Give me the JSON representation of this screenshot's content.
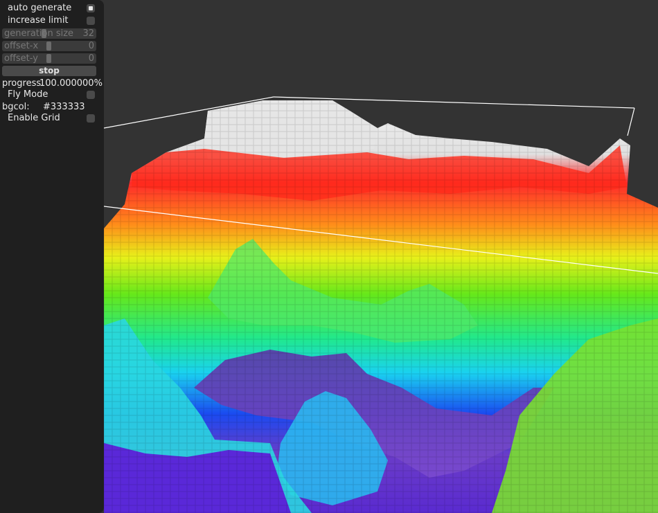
{
  "panel": {
    "auto_generate": {
      "label": "auto generate",
      "checked": true
    },
    "increase_limit": {
      "label": "increase limit",
      "checked": false
    },
    "generation_size": {
      "label": "generation size",
      "value": "32",
      "level": 0.45
    },
    "offset_x": {
      "label": "offset-x",
      "value": "0",
      "level": 0.49
    },
    "offset_y": {
      "label": "offset-y",
      "value": "0",
      "level": 0.49
    },
    "stop_button": {
      "label": "stop"
    },
    "progress": {
      "label": "progress",
      "value": "100.000000%"
    },
    "fly_mode": {
      "label": "Fly Mode",
      "checked": false
    },
    "bgcol": {
      "label": "bgcol:",
      "value": "#333333"
    },
    "enable_grid": {
      "label": "Enable Grid",
      "checked": false
    }
  },
  "colors": {
    "background": "#333333",
    "panel": "#1f1f1f",
    "bounding_box": "#ffffff"
  }
}
